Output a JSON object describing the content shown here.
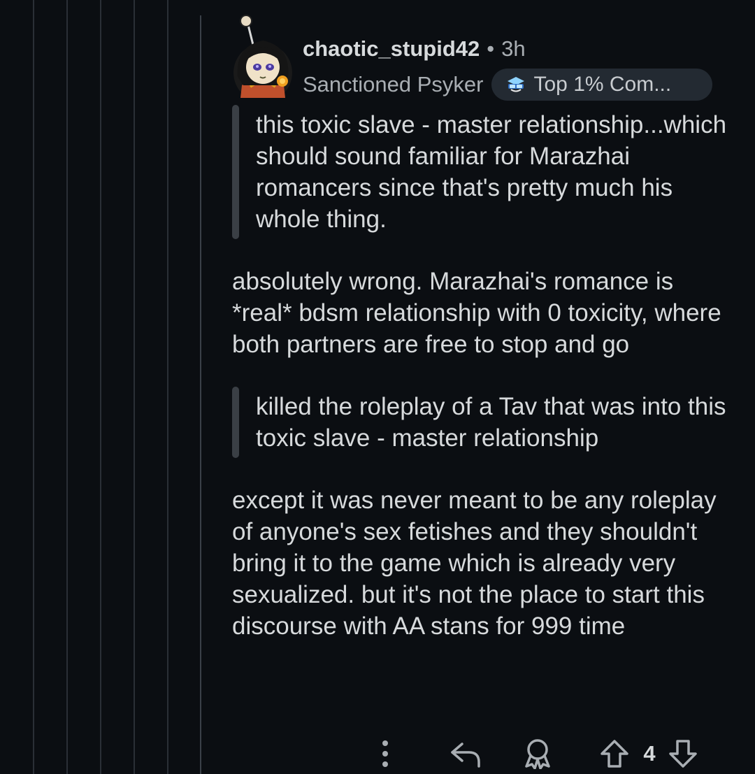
{
  "comment": {
    "username": "chaotic_stupid42",
    "separator": "•",
    "time_ago": "3h",
    "user_flair": "Sanctioned Psyker",
    "achievement": "Top 1% Com...",
    "quote_1": "this toxic slave - master relationship...which should sound familiar for Marazhai romancers since that's pretty much his whole thing.",
    "paragraph_1": "absolutely wrong. Marazhai's romance is *real* bdsm relationship with 0 toxicity, where both partners are free to stop and go",
    "quote_2": "killed the roleplay of a Tav that was into this toxic slave - master relationship",
    "paragraph_2": "except it was never meant to be any roleplay of anyone's sex fetishes and they shouldn't bring it to the game which is already very sexualized. but it's not the place to start this discourse with AA stans for 999 time"
  },
  "actions": {
    "more": "more-options-icon",
    "reply": "reply-icon",
    "award": "award-icon",
    "upvote": "upvote-icon",
    "vote_count": "4",
    "downvote": "downvote-icon"
  },
  "colors": {
    "background": "#0b0e12",
    "text": "#d7dadc",
    "secondary_text": "#a9aeb3",
    "thread_line": "#2a2f36",
    "quote_bar": "#3a3f45",
    "flair_bg": "#232a32"
  }
}
